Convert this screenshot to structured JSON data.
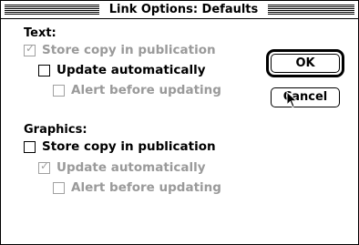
{
  "dialog": {
    "title": "Link Options: Defaults"
  },
  "text_section": {
    "label": "Text:",
    "store_copy": {
      "label": "Store copy in publication",
      "checked": true,
      "enabled": false
    },
    "update_auto": {
      "label": "Update automatically",
      "checked": false,
      "enabled": true
    },
    "alert_before": {
      "label": "Alert before updating",
      "checked": false,
      "enabled": false
    }
  },
  "graphics_section": {
    "label": "Graphics:",
    "store_copy": {
      "label": "Store copy in publication",
      "checked": false,
      "enabled": true
    },
    "update_auto": {
      "label": "Update automatically",
      "checked": true,
      "enabled": false
    },
    "alert_before": {
      "label": "Alert before updating",
      "checked": false,
      "enabled": false
    }
  },
  "buttons": {
    "ok_label": "OK",
    "cancel_label": "Cancel"
  },
  "icons": {
    "checkmark": "checkmark-icon",
    "cursor": "arrow-cursor-icon"
  },
  "colors": {
    "disabled_text": "#9a9a9a",
    "frame": "#000000",
    "background": "#ffffff"
  }
}
